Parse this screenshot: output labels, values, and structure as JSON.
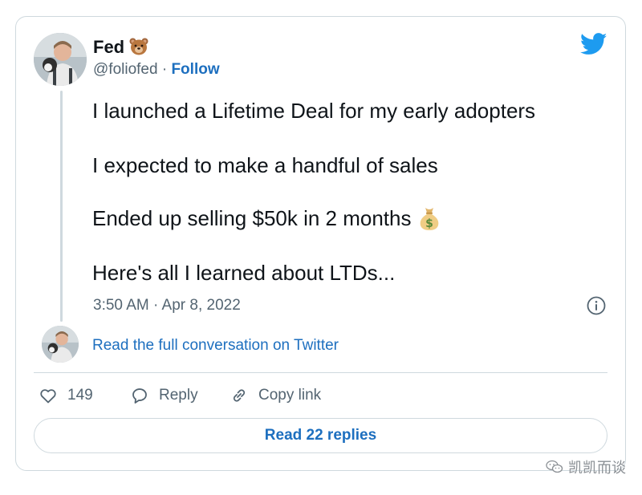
{
  "author": {
    "name": "Fed",
    "handle": "@foliofed",
    "separator": " · ",
    "follow_label": "Follow",
    "name_emoji": "bear-face-icon"
  },
  "tweet": {
    "lines": [
      "I launched a Lifetime Deal for my early adopters",
      "I expected to make a handful of sales",
      "Ended up selling $50k in 2 months",
      "Here's all I learned about LTDs..."
    ],
    "line3_emoji": "money-bag-icon",
    "timestamp": "3:50 AM · Apr 8, 2022"
  },
  "conversation": {
    "read_full_label": "Read the full conversation on Twitter"
  },
  "actions": {
    "like_count": "149",
    "reply_label": "Reply",
    "copy_link_label": "Copy link"
  },
  "replies_button": {
    "label": "Read 22 replies"
  },
  "watermark": {
    "text": "凯凯而谈"
  },
  "colors": {
    "twitter_blue": "#1d9bf0",
    "link_blue": "#1d6fbf",
    "secondary_text": "#536471",
    "border": "#cfd9de"
  }
}
